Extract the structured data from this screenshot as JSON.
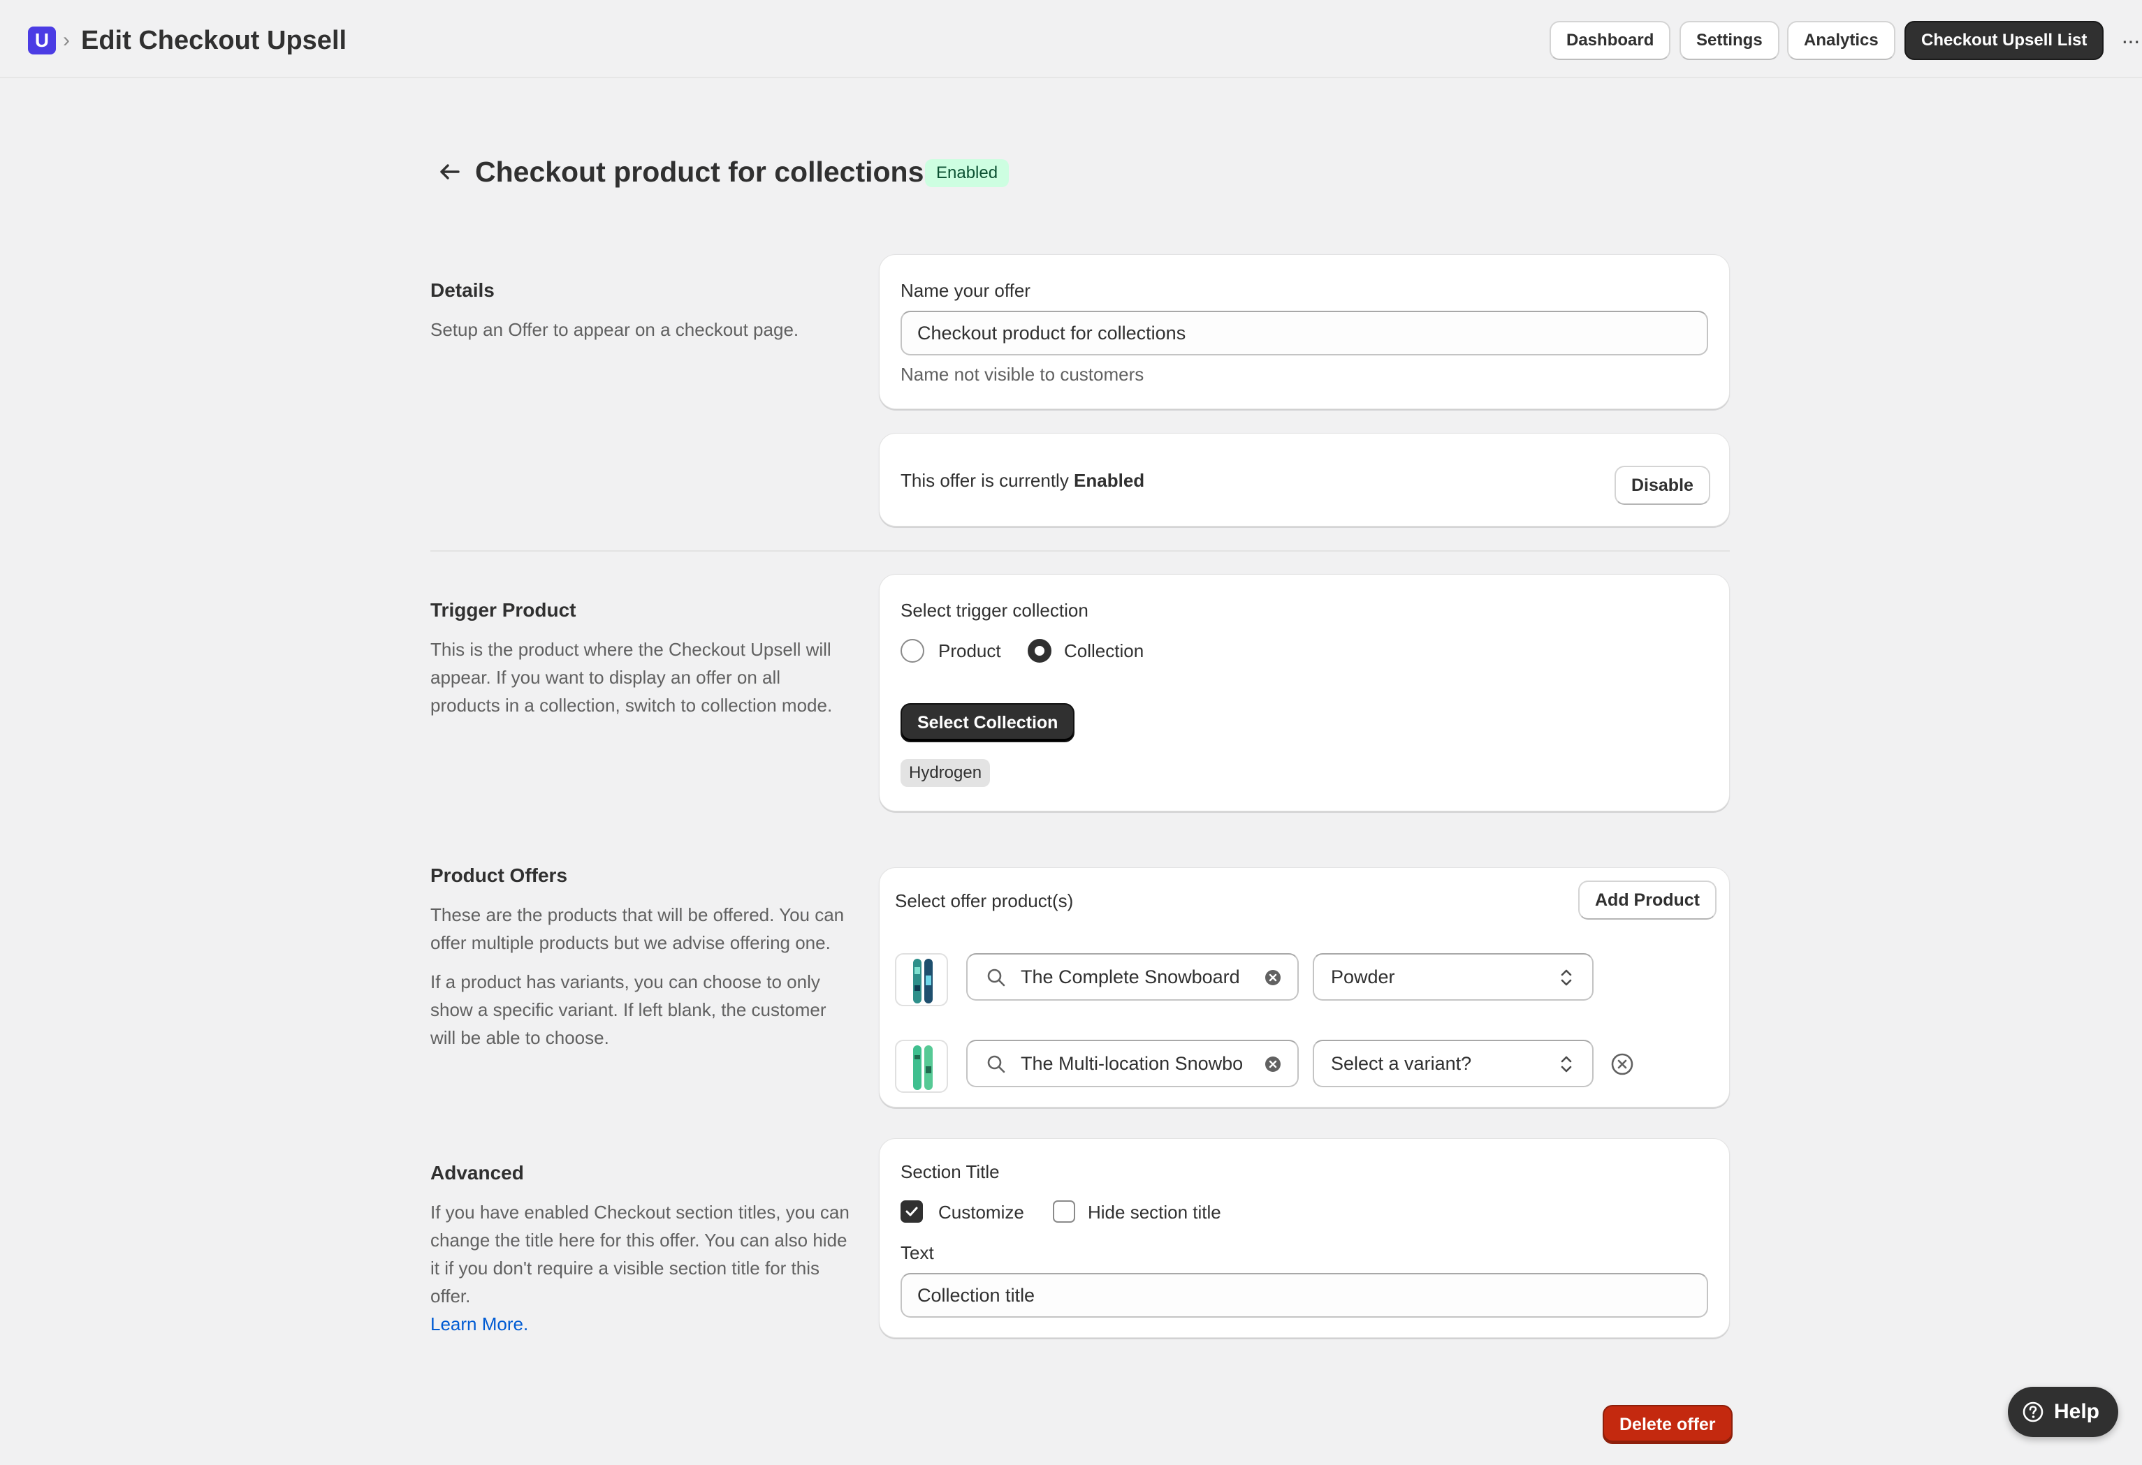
{
  "topbar": {
    "app_logo_letter": "U",
    "breadcrumb_separator": "›",
    "title": "Edit Checkout Upsell",
    "nav": {
      "dashboard": "Dashboard",
      "settings": "Settings",
      "analytics": "Analytics",
      "upsell_list": "Checkout Upsell List"
    },
    "more": "···"
  },
  "page": {
    "title": "Checkout product for collections",
    "status": "Enabled"
  },
  "details": {
    "title": "Details",
    "description": "Setup an Offer to appear on a checkout page.",
    "name_label": "Name your offer",
    "name_value": "Checkout product for collections",
    "name_hint": "Name not visible to customers",
    "status_prefix": "This offer is currently ",
    "status_value": "Enabled",
    "disable_label": "Disable"
  },
  "trigger": {
    "title": "Trigger Product",
    "description": "This is the product where the Checkout Upsell will appear. If you want to display an offer on all products in a collection, switch to collection mode.",
    "select_label": "Select trigger collection",
    "options": [
      "Product",
      "Collection"
    ],
    "selected": "Collection",
    "select_button": "Select Collection",
    "selected_tag": "Hydrogen"
  },
  "offers": {
    "title": "Product Offers",
    "description_1": "These are the products that will be offered. You can offer multiple products but we advise offering one.",
    "description_2": "If a product has variants, you can choose to only show a specific variant. If left blank, the customer will be able to choose.",
    "select_label": "Select offer product(s)",
    "add_button": "Add Product",
    "items": [
      {
        "product": "The Complete Snowboard",
        "variant": "Powder"
      },
      {
        "product": "The Multi-location Snowbo",
        "variant": "Select a variant?"
      }
    ]
  },
  "advanced": {
    "title": "Advanced",
    "description": "If you have enabled Checkout section titles, you can change the title here for this offer. You can also hide it if you don't require a visible section title for this offer.",
    "learn_more": "Learn More.",
    "section_title_label": "Section Title",
    "customize_label": "Customize",
    "customize_checked": true,
    "hide_label": "Hide section title",
    "hide_checked": false,
    "text_label": "Text",
    "text_value": "Collection title"
  },
  "footer": {
    "delete_label": "Delete offer",
    "help_label": "Help"
  },
  "colors": {
    "brand": "#4b3ce4",
    "dark_button": "#303030",
    "danger": "#c4290f",
    "enabled_badge_bg": "#cdfee1",
    "link": "#005bd3"
  }
}
